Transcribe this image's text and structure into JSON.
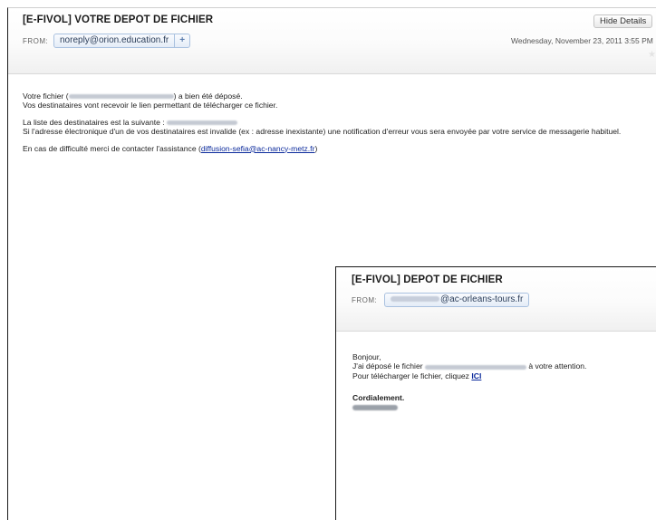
{
  "email1": {
    "subject": "[E-FIVOL] VOTRE DEPOT DE FICHIER",
    "from_label": "FROM:",
    "from_address": "noreply@orion.education.fr",
    "add_contact_symbol": "+",
    "date": "Wednesday, November 23, 2011 3:55 PM",
    "hide_details_label": "Hide Details",
    "star_icon": "star-icon",
    "line1_before": "Votre fichier (",
    "line1_after": ") a bien été déposé.",
    "line2": "Vos destinataires vont recevoir le lien permettant de télécharger ce fichier.",
    "line3": "La liste des destinataires est la suivante :",
    "line4": "Si l'adresse électronique d'un de vos destinataires est invalide (ex : adresse inexistante) une notification d'erreur vous sera envoyée par votre service de messagerie habituel.",
    "line5_before": "En cas de difficulté merci de contacter l'assistance (",
    "assistance_link": "diffusion-sefia@ac-nancy-metz.fr",
    "line5_after": ")"
  },
  "email2": {
    "subject": "[E-FIVOL] DEPOT DE FICHIER",
    "from_label": "FROM:",
    "from_domain": "@ac-orleans-tours.fr",
    "greeting": "Bonjour,",
    "line1_before": "J'ai déposé le fichier",
    "line1_after": "à  votre attention.",
    "line2_before": "Pour télécharger le fichier, cliquez ",
    "ici_link": "ICI",
    "closing": "Cordialement."
  },
  "colors": {
    "link": "#0b2a9c",
    "pill_border": "#a9c1df",
    "header_gradient_end": "#f0f0f0"
  }
}
